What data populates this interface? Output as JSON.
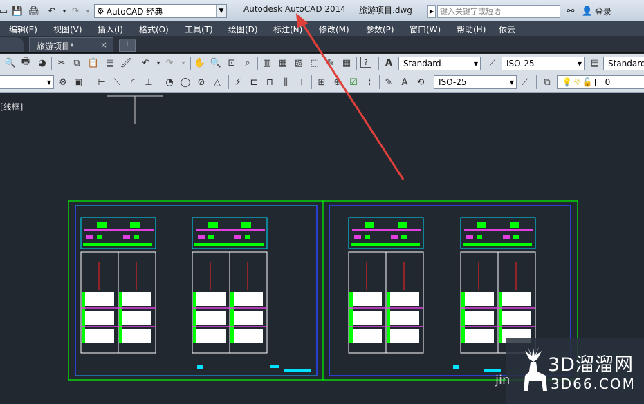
{
  "titlebar": {
    "workspace": "AutoCAD 经典",
    "app_title": "Autodesk AutoCAD 2014",
    "doc_title": "旅游项目.dwg",
    "search_placeholder": "键入关键字或短语",
    "login": "登录"
  },
  "menu": [
    "编辑(E)",
    "视图(V)",
    "插入(I)",
    "格式(O)",
    "工具(T)",
    "绘图(D)",
    "标注(N)",
    "修改(M)",
    "参数(P)",
    "窗口(W)",
    "帮助(H)",
    "依云"
  ],
  "tabs": {
    "active": "旅游项目*",
    "close": "×"
  },
  "styles": {
    "text_style": "Standard",
    "dim_style": "ISO-25",
    "table_style": "Standard",
    "dim_style_2": "ISO-25",
    "layer_value": "0"
  },
  "viewport_label": "[线框]",
  "watermark": {
    "cn": "3D溜溜网",
    "en": "3D66.COM",
    "partial": "jin"
  },
  "colors": {
    "canvas": "#212830",
    "frame": "#00ff00",
    "inner": "#2a3ecf",
    "arrow": "#e0403a",
    "accent_cyan": "#00e0ff",
    "accent_magenta": "#e040e0"
  }
}
